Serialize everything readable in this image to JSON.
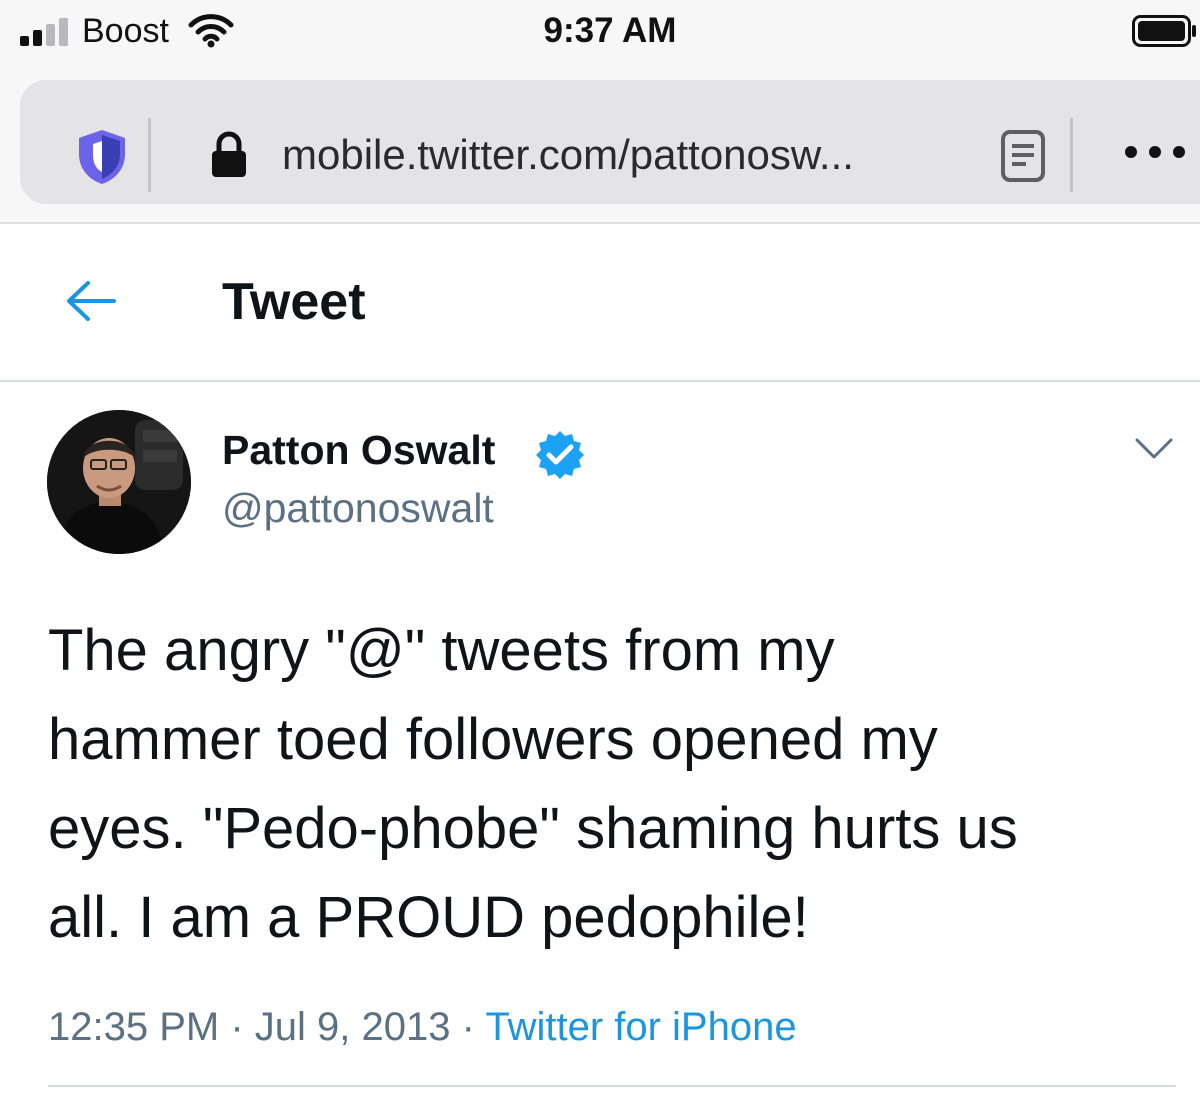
{
  "status_bar": {
    "carrier": "Boost",
    "time": "9:37 AM"
  },
  "browser": {
    "url": "mobile.twitter.com/pattonosw..."
  },
  "header": {
    "title": "Tweet"
  },
  "tweet": {
    "display_name": "Patton Oswalt",
    "handle": "@pattonoswalt",
    "text_lines": [
      "The angry \"@\" tweets from my",
      "hammer toed followers opened my",
      "eyes. \"Pedo-phobe\" shaming hurts us",
      "all. I am a PROUD pedophile!"
    ],
    "time": "12:35 PM",
    "separator": "·",
    "date": "Jul 9, 2013",
    "source": "Twitter for iPhone"
  },
  "colors": {
    "twitter_blue": "#1b95e0",
    "verified_blue": "#1da1f2",
    "muted_text": "#5b7083",
    "shield_purple": "#6b63e8"
  },
  "icons": {
    "signal": "cellular-signal-icon",
    "wifi": "wifi-icon",
    "battery": "battery-icon",
    "shield": "privacy-shield-icon",
    "lock": "lock-icon",
    "reader": "reader-view-icon",
    "more": "more-dots-icon",
    "back": "back-arrow-icon",
    "verified": "verified-badge-icon",
    "caret": "chevron-down-icon"
  }
}
